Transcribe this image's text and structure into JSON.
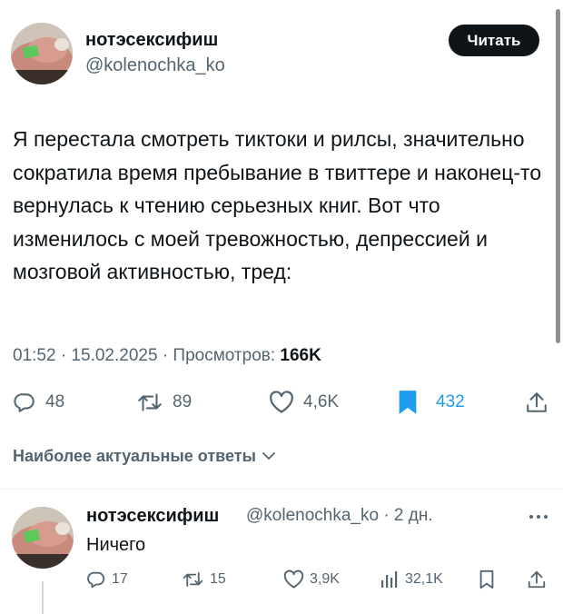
{
  "tweet": {
    "author_name": "нотэсексифиш",
    "author_handle": "@kolenochka_ko",
    "follow_label": "Читать",
    "text": "Я перестала смотреть тиктоки и рилсы, значительно сократила время пребывание в твиттере и наконец-то вернулась к чтению серьезных книг. Вот что изменилось с моей тревожностью, депрессией и мозговой активностью, тред:",
    "timestamp": "01:52 · 15.02.2025 · ",
    "views_label": "Просмотров: ",
    "views_count": "166K",
    "actions": {
      "replies": "48",
      "reposts": "89",
      "likes": "4,6K",
      "bookmarks": "432"
    },
    "icons": [
      "reply-icon",
      "repost-icon",
      "like-icon",
      "bookmark-icon",
      "share-icon"
    ],
    "bookmark_color": "#1d9bf0"
  },
  "replies_header": "Наиболее актуальные ответы",
  "reply": {
    "author_name": "нотэсексифиш",
    "author_handle": "@kolenochka_ko · 2 дн.",
    "text": "Ничего",
    "actions": {
      "replies": "17",
      "reposts": "15",
      "likes": "3,9K",
      "views": "32,1K"
    },
    "icons": [
      "reply-icon",
      "repost-icon",
      "like-icon",
      "views-icon",
      "bookmark-icon",
      "share-icon",
      "more-icon"
    ]
  }
}
